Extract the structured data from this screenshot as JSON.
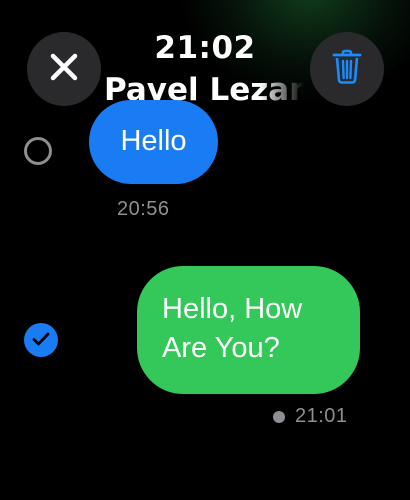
{
  "header": {
    "time": "21:02",
    "contact_name": "Pavel Lezam"
  },
  "toolbar": {
    "close_icon": "close-icon",
    "delete_icon": "trash-icon"
  },
  "messages": [
    {
      "direction": "incoming",
      "text": "Hello",
      "timestamp": "20:56",
      "selected": false
    },
    {
      "direction": "outgoing",
      "text": "Hello, How Are You?",
      "timestamp": "21:01",
      "selected": true
    }
  ],
  "colors": {
    "incoming_bubble": "#1a7cf2",
    "outgoing_bubble": "#34c759",
    "button_background": "#2a2a2c",
    "accent": "#1a7cf2",
    "secondary_text": "#8e8e93"
  }
}
